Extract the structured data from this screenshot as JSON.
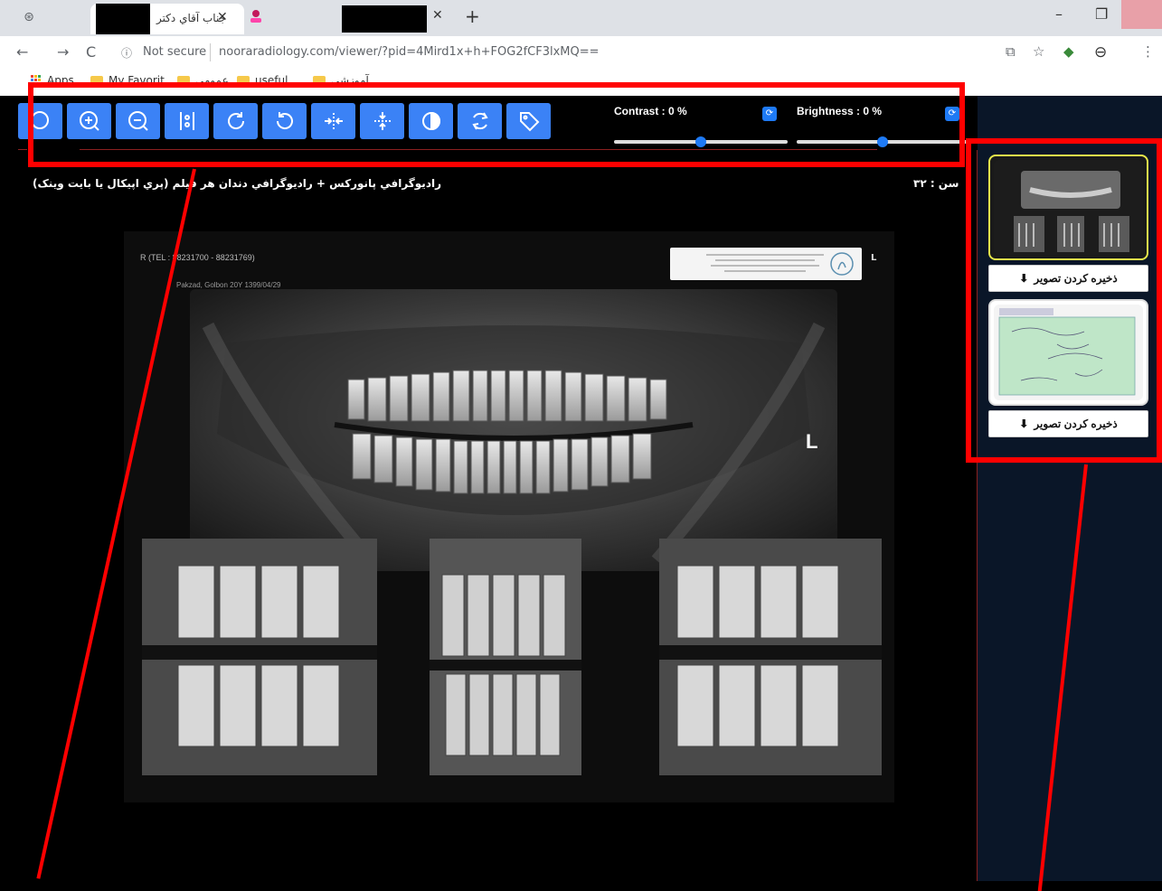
{
  "browser": {
    "tab1_title": "جناب آقاي دکتر",
    "url_prefix": "Not secure",
    "url": "nooraradiology.com/viewer/?pid=4Mird1x+h+FOG2fCF3lxMQ==",
    "bookmarks": {
      "apps": "Apps",
      "my_favorit": "My Favorit",
      "general": "عمومی",
      "useful": "useful",
      "educational": "آموزشی"
    }
  },
  "viewer": {
    "tools": [
      {
        "icon": "search-icon"
      },
      {
        "icon": "zoom-in-icon"
      },
      {
        "icon": "zoom-out-icon"
      },
      {
        "icon": "flip-vertical-icon"
      },
      {
        "icon": "rotate-right-icon"
      },
      {
        "icon": "rotate-left-icon"
      },
      {
        "icon": "merge-horizontal-icon"
      },
      {
        "icon": "merge-vertical-icon"
      },
      {
        "icon": "invert-contrast-icon"
      },
      {
        "icon": "reset-icon"
      },
      {
        "icon": "tag-icon"
      }
    ],
    "contrast": {
      "label": "Contrast : 0 %",
      "value_percent": 0,
      "position": 0.5
    },
    "brightness": {
      "label": "Brightness : 0 %",
      "value_percent": 0,
      "position": 0.5
    },
    "description": "راديوگرافي پانورکس + راديوگرافي دندان هر فيلم (پري اپيکال يا بايت وينک)",
    "age": "سن : ۳۲",
    "xray": {
      "header": "R      (TEL : 88231700 - 88231769)",
      "patient": "Pakzad, Golbon 20Y 1399/04/29",
      "pano_marker": "L",
      "top_marker": "L"
    }
  },
  "sidebar": {
    "save_label_1": "ذخیره کردن تصویر",
    "save_label_2": "ذخیره کردن تصویر"
  },
  "colors": {
    "tool_blue": "#3b82f6",
    "annotation_red": "#ff0000",
    "sidebar_bg": "#0a1628",
    "thumb_highlight": "#e8e84a"
  }
}
